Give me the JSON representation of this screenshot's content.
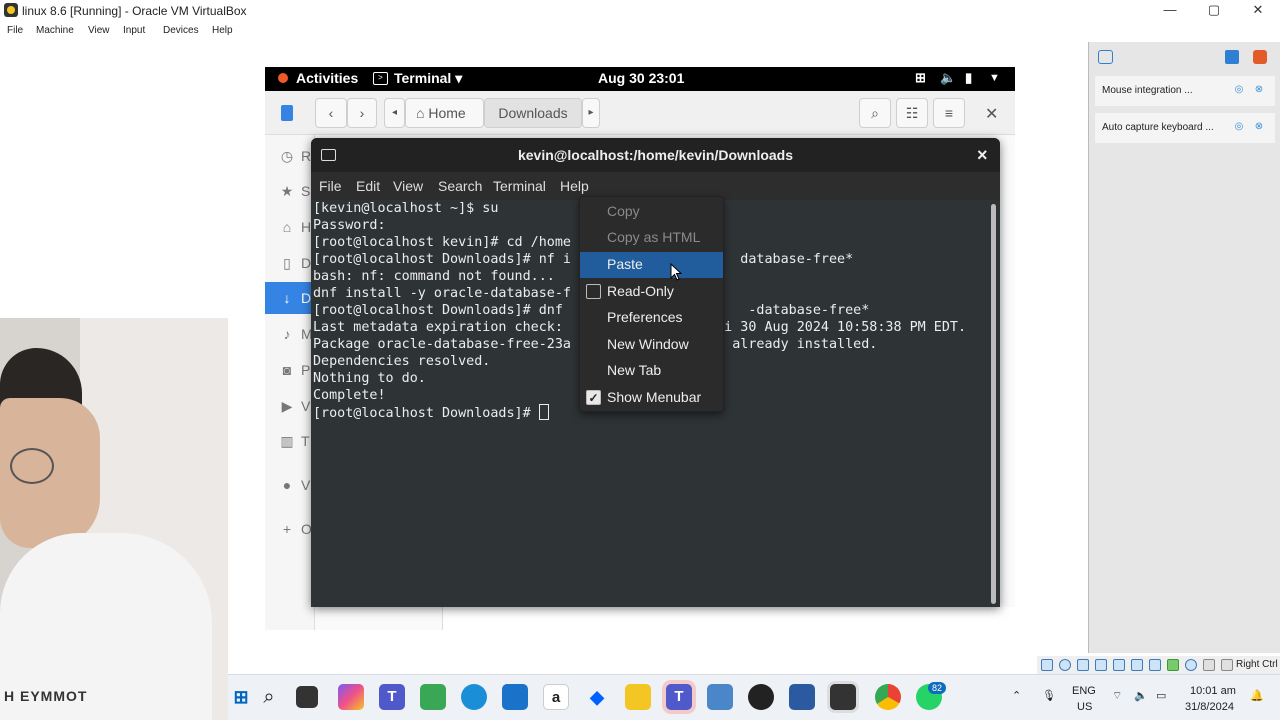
{
  "host_window": {
    "title": "linux 8.6 [Running] - Oracle VM VirtualBox",
    "controls": {
      "minimize": "—",
      "maximize": "▢",
      "close": "✕"
    },
    "menu": [
      "File",
      "Machine",
      "View",
      "Input",
      "Devices",
      "Help"
    ]
  },
  "gnome_bar": {
    "activities": "Activities",
    "app_menu": "Terminal ▾",
    "clock": "Aug 30  23:01"
  },
  "files": {
    "path": [
      "Home",
      "Downloads"
    ],
    "sidebar_initials": [
      "R",
      "S",
      "H",
      "D",
      "D",
      "M",
      "P",
      "V",
      "T",
      "V",
      "O"
    ]
  },
  "terminal": {
    "title": "kevin@localhost:/home/kevin/Downloads",
    "close": "×",
    "menu": [
      "File",
      "Edit",
      "View",
      "Search",
      "Terminal",
      "Help"
    ],
    "lines": [
      "[kevin@localhost ~]$ su",
      "Password:",
      "[root@localhost kevin]# cd /home",
      "[root@localhost Downloads]# nf i                     database-free*",
      "bash: nf: command not found...",
      "dnf install -y oracle-database-f",
      "[root@localhost Downloads]# dnf                       -database-free*",
      "Last metadata expiration check:                    i 30 Aug 2024 10:58:38 PM EDT.",
      "Package oracle-database-free-23a                    already installed.",
      "Dependencies resolved.",
      "Nothing to do.",
      "Complete!",
      "[root@localhost Downloads]# "
    ]
  },
  "context_menu": {
    "items": [
      {
        "label": "Copy",
        "state": "disabled"
      },
      {
        "label": "Copy as HTML",
        "state": "disabled"
      },
      {
        "label": "Paste",
        "state": "highlighted"
      },
      {
        "label": "Read-Only",
        "check": "unchecked"
      },
      {
        "label": "Preferences"
      },
      {
        "label": "New Window"
      },
      {
        "label": "New Tab"
      },
      {
        "label": "Show Menubar",
        "check": "checked"
      }
    ]
  },
  "vb_panel": {
    "notifications": [
      "Mouse integration ...",
      "Auto capture keyboard ..."
    ],
    "host_key": "Right Ctrl"
  },
  "webcam": {
    "shirt_text": "H EYMMOT"
  },
  "taskbar": {
    "lang": "ENG",
    "region": "US",
    "time": "10:01 am",
    "date": "31/8/2024",
    "whatsapp_badge": "82"
  },
  "colors": {
    "gnome_bar": "#000000",
    "terminal_bg": "#2e3436",
    "menu_highlight": "#215d9c",
    "files_accent": "#3584e4"
  }
}
